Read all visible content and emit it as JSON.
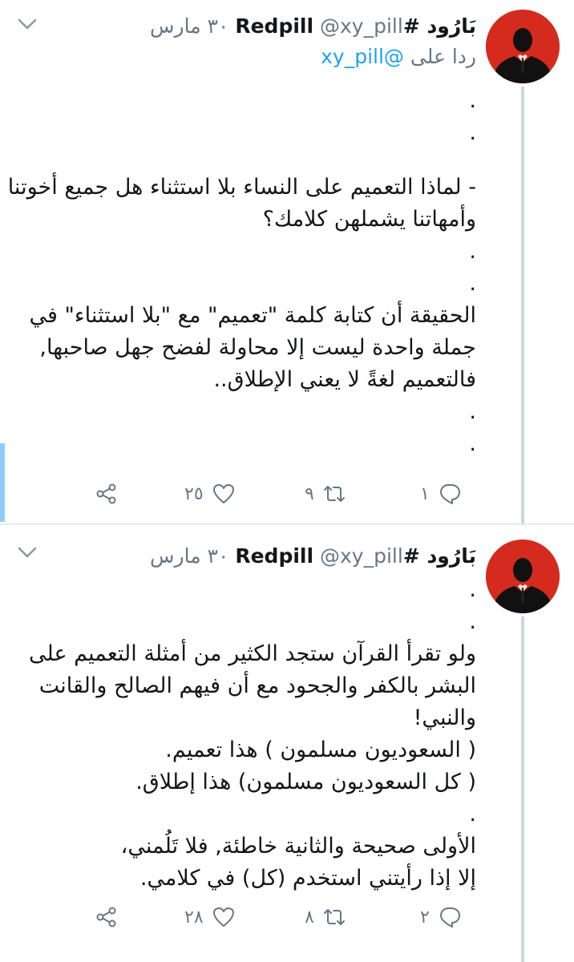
{
  "tweets": [
    {
      "author": {
        "name": "بَارُود #Redpill",
        "handle": "@xy_pill",
        "date": "٣٠ مارس"
      },
      "reply_to": {
        "prefix": "ردا على",
        "mention": "@xy_pill"
      },
      "lines": [
        ".",
        ".",
        "",
        "- لماذا التعميم على النساء بلا استثناء هل جميع أخوتنا",
        "وأمهاتنا يشملهن كلامك؟",
        ".",
        ".",
        "الحقيقة أن كتابة كلمة \"تعميم\" مع \"بلا استثناء\" في",
        "جملة واحدة ليست إلا محاولة لفضح جهل صاحبها,",
        "فالتعميم لغةً لا يعني الإطلاق..",
        ".",
        "."
      ],
      "actions": {
        "replies": "١",
        "retweets": "٩",
        "likes": "٢٥"
      }
    },
    {
      "author": {
        "name": "بَارُود #Redpill",
        "handle": "@xy_pill",
        "date": "٣٠ مارس"
      },
      "lines": [
        ".",
        ".",
        "ولو تقرأ القرآن ستجد الكثير من أمثلة التعميم على",
        "البشر بالكفر والجحود مع أن فيهم الصالح والقانت",
        "والنبي!",
        "( السعوديون مسلمون ) هذا تعميم.",
        "( كل السعوديون مسلمون) هذا إطلاق.",
        ".",
        "الأولى صحيحة والثانية خاطئة, فلا تَلُمني،",
        "إلا إذا رأيتني استخدم (كل) في كلامي."
      ],
      "actions": {
        "replies": "٢",
        "retweets": "٨",
        "likes": "٢٨"
      }
    }
  ],
  "colors": {
    "accent": "#1da1f2",
    "muted": "#657786",
    "thread_line": "#ccd6dd",
    "avatar_bg": "#d52b1e"
  },
  "icons": [
    "chevron-down-icon",
    "reply-icon",
    "retweet-icon",
    "like-icon",
    "share-icon"
  ]
}
